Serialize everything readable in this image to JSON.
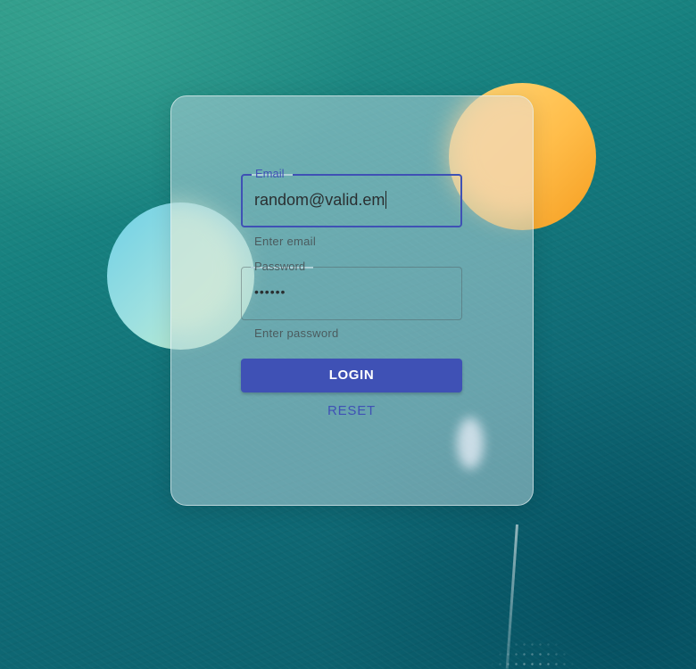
{
  "login_form": {
    "email": {
      "label": "Email",
      "value": "random@valid.em",
      "helper": "Enter email"
    },
    "password": {
      "label": "Password",
      "value": "••••••",
      "helper": "Enter password"
    },
    "login_label": "LOGIN",
    "reset_label": "RESET"
  },
  "colors": {
    "primary": "#3f51b5",
    "orange_circle": "#ffbd4a",
    "teal_circle": "#9de0e0",
    "background": "#0f6b76"
  }
}
